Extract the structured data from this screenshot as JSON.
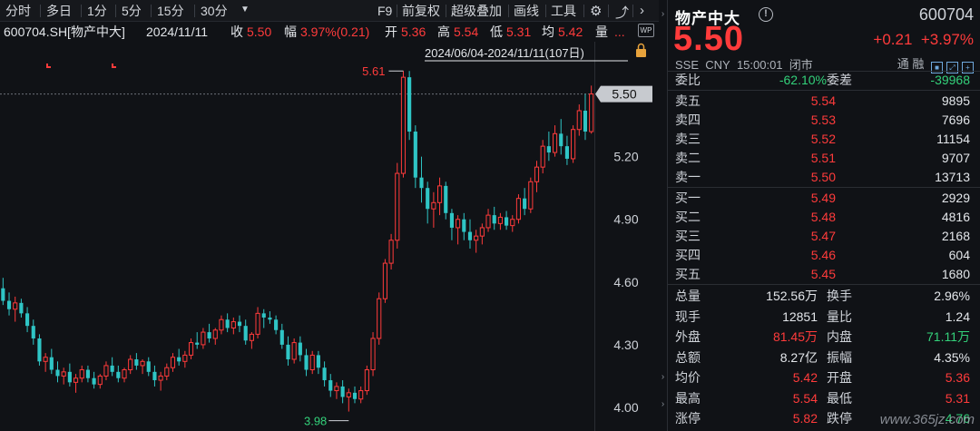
{
  "toolbar": {
    "periods": [
      "分时",
      "多日",
      "1分",
      "5分",
      "15分",
      "30分"
    ],
    "more_icon": "triangle-down-icon",
    "tools": [
      "F9",
      "前复权",
      "超级叠加",
      "画线",
      "工具"
    ],
    "settings_icon": "gear-icon",
    "collapse_icon": "chevron-right-icon"
  },
  "info": {
    "symbol": "600704.SH[物产中大]",
    "date": "2024/11/11",
    "close_label": "收",
    "close": "5.50",
    "amp_label": "幅",
    "amp": "3.97%(0.21)",
    "open_label": "开",
    "open": "5.36",
    "high_label": "高",
    "high": "5.54",
    "low_label": "低",
    "low": "5.31",
    "avg_label": "均",
    "avg": "5.42",
    "vol_label": "量",
    "vol": "...",
    "range": "2024/06/04-2024/11/11(107日)",
    "wp_badge": "WP"
  },
  "chart_data": {
    "type": "candlestick",
    "title": "",
    "ylim": [
      3.9,
      5.75
    ],
    "yticks": [
      "5.20",
      "4.90",
      "4.60",
      "4.30",
      "4.00"
    ],
    "yticks_values": [
      5.2,
      4.9,
      4.6,
      4.3,
      4.0
    ],
    "current_price": "5.50",
    "current_price_value": 5.5,
    "high_annotation": "5.61",
    "low_annotation": "3.98",
    "colors": {
      "up": "#ff3b3b",
      "down": "#2fc5c5",
      "bg": "#101216",
      "grid": "#2a2d33"
    },
    "candles": [
      [
        4.57,
        4.62,
        4.49,
        4.51
      ],
      [
        4.51,
        4.55,
        4.44,
        4.47
      ],
      [
        4.47,
        4.53,
        4.41,
        4.5
      ],
      [
        4.5,
        4.52,
        4.43,
        4.45
      ],
      [
        4.45,
        4.48,
        4.36,
        4.39
      ],
      [
        4.39,
        4.42,
        4.3,
        4.33
      ],
      [
        4.33,
        4.35,
        4.2,
        4.22
      ],
      [
        4.22,
        4.26,
        4.17,
        4.24
      ],
      [
        4.24,
        4.28,
        4.16,
        4.18
      ],
      [
        4.18,
        4.22,
        4.12,
        4.15
      ],
      [
        4.15,
        4.19,
        4.11,
        4.17
      ],
      [
        4.17,
        4.21,
        4.1,
        4.12
      ],
      [
        4.12,
        4.16,
        4.07,
        4.14
      ],
      [
        4.14,
        4.2,
        4.12,
        4.18
      ],
      [
        4.18,
        4.2,
        4.12,
        4.14
      ],
      [
        4.14,
        4.17,
        4.09,
        4.11
      ],
      [
        4.11,
        4.16,
        4.09,
        4.15
      ],
      [
        4.15,
        4.22,
        4.13,
        4.2
      ],
      [
        4.2,
        4.24,
        4.15,
        4.17
      ],
      [
        4.17,
        4.2,
        4.12,
        4.14
      ],
      [
        4.14,
        4.19,
        4.12,
        4.18
      ],
      [
        4.18,
        4.25,
        4.16,
        4.23
      ],
      [
        4.23,
        4.26,
        4.18,
        4.2
      ],
      [
        4.2,
        4.23,
        4.16,
        4.22
      ],
      [
        4.22,
        4.24,
        4.15,
        4.17
      ],
      [
        4.17,
        4.2,
        4.1,
        4.13
      ],
      [
        4.13,
        4.17,
        4.08,
        4.15
      ],
      [
        4.15,
        4.21,
        4.13,
        4.19
      ],
      [
        4.19,
        4.26,
        4.17,
        4.24
      ],
      [
        4.24,
        4.28,
        4.2,
        4.22
      ],
      [
        4.22,
        4.27,
        4.19,
        4.25
      ],
      [
        4.25,
        4.33,
        4.23,
        4.31
      ],
      [
        4.31,
        4.36,
        4.28,
        4.3
      ],
      [
        4.3,
        4.38,
        4.28,
        4.36
      ],
      [
        4.36,
        4.4,
        4.31,
        4.33
      ],
      [
        4.33,
        4.38,
        4.3,
        4.37
      ],
      [
        4.37,
        4.44,
        4.35,
        4.42
      ],
      [
        4.42,
        4.45,
        4.36,
        4.38
      ],
      [
        4.38,
        4.43,
        4.35,
        4.41
      ],
      [
        4.41,
        4.44,
        4.36,
        4.39
      ],
      [
        4.39,
        4.42,
        4.3,
        4.32
      ],
      [
        4.32,
        4.36,
        4.28,
        4.35
      ],
      [
        4.35,
        4.48,
        4.33,
        4.45
      ],
      [
        4.45,
        4.47,
        4.38,
        4.43
      ],
      [
        4.43,
        4.46,
        4.4,
        4.42
      ],
      [
        4.42,
        4.44,
        4.35,
        4.37
      ],
      [
        4.37,
        4.4,
        4.28,
        4.3
      ],
      [
        4.3,
        4.34,
        4.2,
        4.23
      ],
      [
        4.23,
        4.33,
        4.21,
        4.31
      ],
      [
        4.31,
        4.34,
        4.22,
        4.25
      ],
      [
        4.25,
        4.28,
        4.15,
        4.18
      ],
      [
        4.18,
        4.27,
        4.16,
        4.25
      ],
      [
        4.25,
        4.27,
        4.16,
        4.19
      ],
      [
        4.19,
        4.22,
        4.1,
        4.13
      ],
      [
        4.13,
        4.16,
        4.05,
        4.08
      ],
      [
        4.08,
        4.12,
        4.04,
        4.1
      ],
      [
        4.1,
        4.13,
        4.02,
        4.05
      ],
      [
        4.05,
        4.09,
        3.98,
        4.07
      ],
      [
        4.07,
        4.1,
        4.02,
        4.04
      ],
      [
        4.04,
        4.1,
        4.02,
        4.08
      ],
      [
        4.08,
        4.2,
        4.06,
        4.18
      ],
      [
        4.18,
        4.36,
        4.15,
        4.33
      ],
      [
        4.33,
        4.55,
        4.3,
        4.52
      ],
      [
        4.52,
        4.71,
        4.5,
        4.69
      ],
      [
        4.69,
        4.83,
        4.66,
        4.8
      ],
      [
        4.8,
        5.17,
        4.76,
        5.12
      ],
      [
        5.12,
        5.61,
        5.1,
        5.58
      ],
      [
        5.58,
        5.61,
        5.28,
        5.32
      ],
      [
        5.32,
        5.35,
        5.05,
        5.1
      ],
      [
        5.1,
        5.2,
        4.98,
        5.05
      ],
      [
        5.05,
        5.08,
        4.88,
        4.95
      ],
      [
        4.95,
        5.03,
        4.86,
        4.98
      ],
      [
        4.98,
        5.1,
        4.92,
        5.06
      ],
      [
        5.06,
        5.08,
        4.9,
        4.93
      ],
      [
        4.93,
        4.95,
        4.8,
        4.86
      ],
      [
        4.86,
        4.92,
        4.78,
        4.9
      ],
      [
        4.9,
        4.93,
        4.8,
        4.84
      ],
      [
        4.84,
        4.9,
        4.76,
        4.8
      ],
      [
        4.8,
        4.85,
        4.74,
        4.82
      ],
      [
        4.82,
        4.88,
        4.78,
        4.86
      ],
      [
        4.86,
        4.95,
        4.84,
        4.92
      ],
      [
        4.92,
        4.96,
        4.85,
        4.88
      ],
      [
        4.88,
        4.93,
        4.85,
        4.91
      ],
      [
        4.91,
        4.94,
        4.85,
        4.87
      ],
      [
        4.87,
        4.92,
        4.84,
        4.9
      ],
      [
        4.9,
        5.02,
        4.88,
        5.0
      ],
      [
        5.0,
        5.05,
        4.92,
        4.95
      ],
      [
        4.95,
        5.1,
        4.93,
        5.08
      ],
      [
        5.08,
        5.18,
        5.03,
        5.15
      ],
      [
        5.15,
        5.28,
        5.12,
        5.25
      ],
      [
        5.25,
        5.32,
        5.18,
        5.22
      ],
      [
        5.22,
        5.35,
        5.2,
        5.31
      ],
      [
        5.31,
        5.38,
        5.21,
        5.25
      ],
      [
        5.25,
        5.3,
        5.16,
        5.19
      ],
      [
        5.19,
        5.35,
        5.17,
        5.33
      ],
      [
        5.33,
        5.45,
        5.3,
        5.42
      ],
      [
        5.42,
        5.5,
        5.28,
        5.32
      ],
      [
        5.32,
        5.54,
        5.31,
        5.5
      ]
    ]
  },
  "quote": {
    "name": "物产中大",
    "info_icon": "info-icon",
    "code": "600704",
    "price": "5.50",
    "change": "+0.21",
    "change_pct": "+3.97%",
    "exchange": "SSE",
    "currency": "CNY",
    "time": "15:00:01",
    "status": "闭市",
    "tags": "通  融"
  },
  "ratio": {
    "label1": "委比",
    "value1": "-62.10%",
    "label2": "委差",
    "value2": "-39968"
  },
  "asks": [
    {
      "label": "卖五",
      "price": "5.54",
      "vol": "9895"
    },
    {
      "label": "卖四",
      "price": "5.53",
      "vol": "7696"
    },
    {
      "label": "卖三",
      "price": "5.52",
      "vol": "11154"
    },
    {
      "label": "卖二",
      "price": "5.51",
      "vol": "9707"
    },
    {
      "label": "卖一",
      "price": "5.50",
      "vol": "13713"
    }
  ],
  "bids": [
    {
      "label": "买一",
      "price": "5.49",
      "vol": "2929"
    },
    {
      "label": "买二",
      "price": "5.48",
      "vol": "4816"
    },
    {
      "label": "买三",
      "price": "5.47",
      "vol": "2168"
    },
    {
      "label": "买四",
      "price": "5.46",
      "vol": "604"
    },
    {
      "label": "买五",
      "price": "5.45",
      "vol": "1680"
    }
  ],
  "stats": [
    {
      "l1": "总量",
      "v1": "152.56万",
      "c1": "white",
      "l2": "换手",
      "v2": "2.96%",
      "c2": "white"
    },
    {
      "l1": "现手",
      "v1": "12851",
      "c1": "white",
      "l2": "量比",
      "v2": "1.24",
      "c2": "white"
    },
    {
      "l1": "外盘",
      "v1": "81.45万",
      "c1": "red",
      "l2": "内盘",
      "v2": "71.11万",
      "c2": "green"
    },
    {
      "l1": "总额",
      "v1": "8.27亿",
      "c1": "white",
      "l2": "振幅",
      "v2": "4.35%",
      "c2": "white"
    },
    {
      "l1": "均价",
      "v1": "5.42",
      "c1": "red",
      "l2": "开盘",
      "v2": "5.36",
      "c2": "red"
    },
    {
      "l1": "最高",
      "v1": "5.54",
      "c1": "red",
      "l2": "最低",
      "v2": "5.31",
      "c2": "red"
    },
    {
      "l1": "涨停",
      "v1": "5.82",
      "c1": "red",
      "l2": "跌停",
      "v2": "4.76",
      "c2": "green"
    }
  ],
  "watermark": "www.365jz.com"
}
